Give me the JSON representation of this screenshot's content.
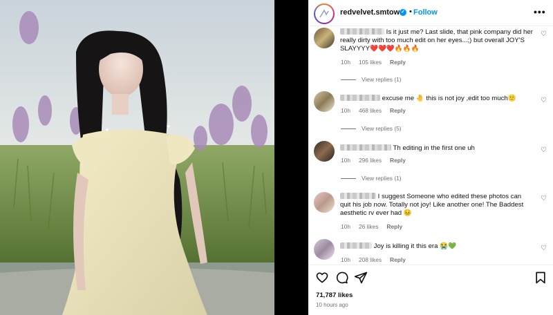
{
  "post": {
    "username": "redvelvet.smtown",
    "verified_icon": "verified-badge-icon",
    "separator": "•",
    "follow_label": "Follow",
    "more_label": "•••",
    "accent_color": "#0095f6"
  },
  "comments": [
    {
      "text": "Is it just me? Last slide, that pink company did her really dirty with too much edit on her eyes...;) but overall JOY'S SLAYYYY❤️❤️❤️🔥🔥🔥",
      "time": "10h",
      "likes": "105 likes",
      "reply": "Reply",
      "view_replies": "View replies (1)"
    },
    {
      "text": "excuse me 🤚 this is not joy ,edit too much🙂",
      "time": "10h",
      "likes": "468 likes",
      "reply": "Reply",
      "view_replies": "View replies (5)"
    },
    {
      "text": "Th editing in the first one uh",
      "time": "10h",
      "likes": "296 likes",
      "reply": "Reply",
      "view_replies": "View replies (1)"
    },
    {
      "text": "I suggest Someone who edited these photos can quit his job now. Totally not joy! Like another one! The Baddest aesthetic rv ever had 😣",
      "time": "10h",
      "likes": "26 likes",
      "reply": "Reply"
    },
    {
      "text": "Joy is killing it this era 😭💚",
      "time": "10h",
      "likes": "208 likes",
      "reply": "Reply"
    }
  ],
  "footer": {
    "likes_count": "71,787 likes",
    "time_ago": "10 hours ago"
  }
}
